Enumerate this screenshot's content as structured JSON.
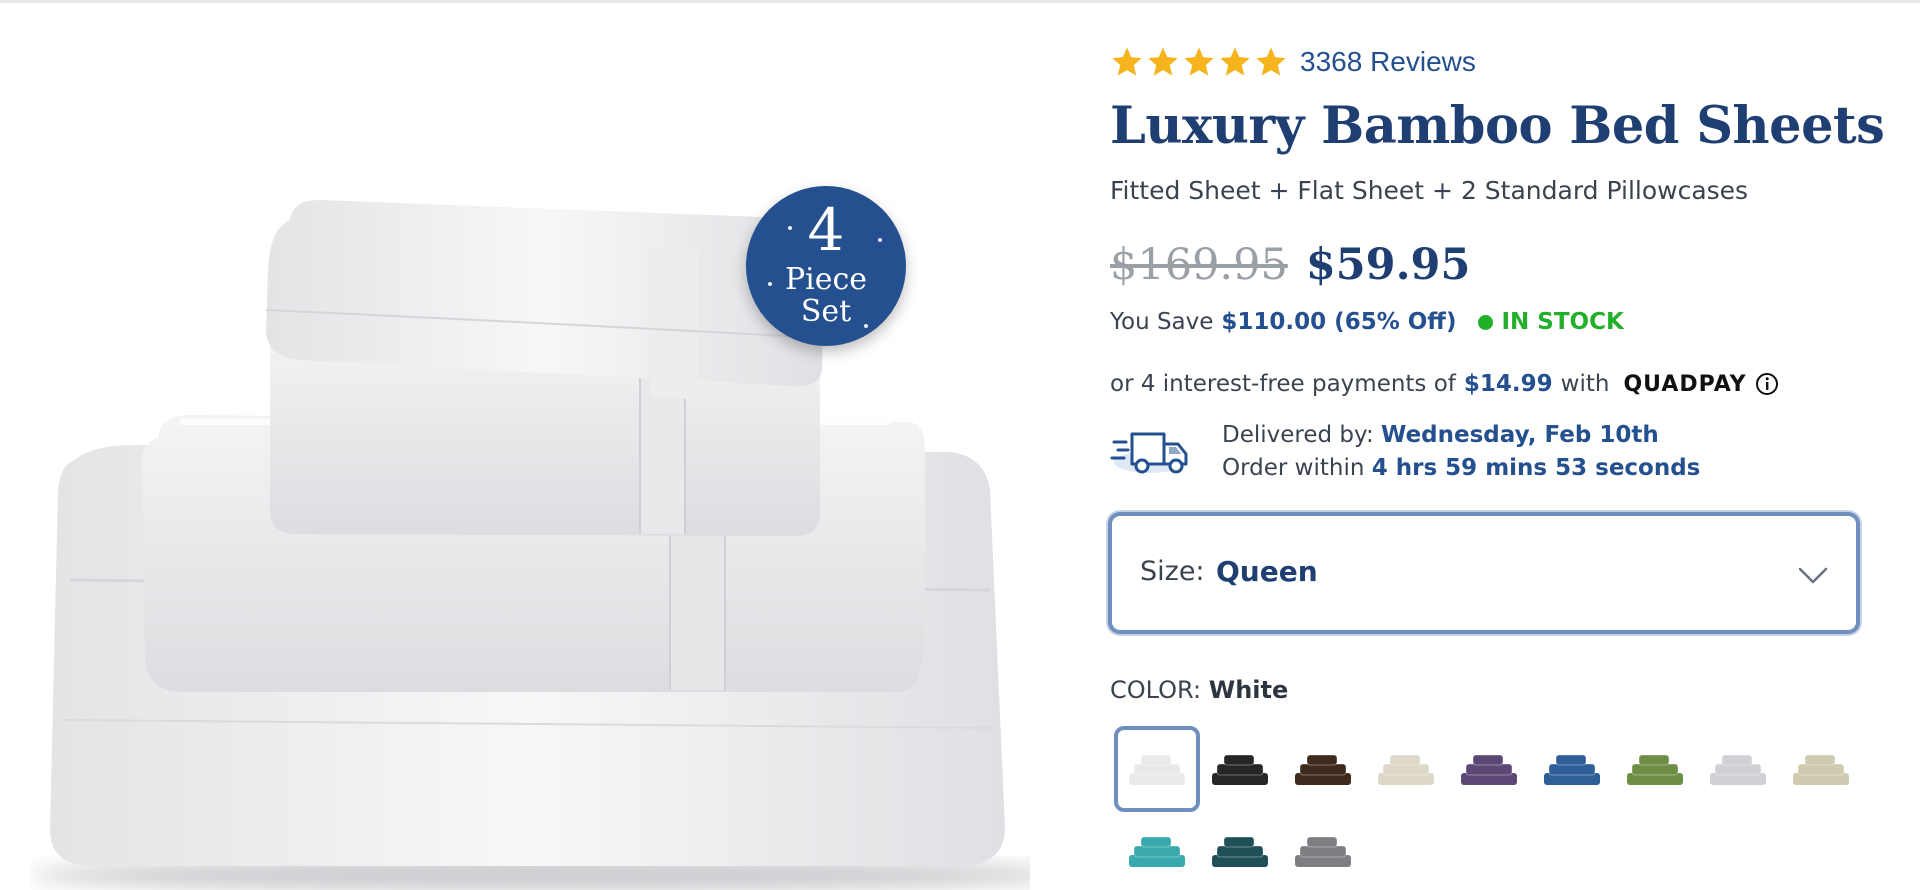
{
  "product": {
    "rating_stars": 5,
    "reviews_label": "3368 Reviews",
    "title": "Luxury Bamboo Bed Sheets",
    "subtitle": "Fitted Sheet + Flat Sheet + 2 Standard Pillowcases",
    "badge": {
      "number": "4",
      "line1": "Piece",
      "line2": "Set"
    }
  },
  "pricing": {
    "original_price": "$169.95",
    "sale_price": "$59.95",
    "save_label": "You Save",
    "save_value": "$110.00 (65% Off)",
    "stock_status": "IN STOCK",
    "stock_color": "#22b02a"
  },
  "payments": {
    "prefix": "or 4 interest-free payments of",
    "amount": "$14.99",
    "suffix": "with",
    "provider": "QUADPAY"
  },
  "delivery": {
    "label": "Delivered by:",
    "date": "Wednesday, Feb 10th",
    "order_label": "Order within",
    "countdown": "4 hrs 59 mins 53 seconds"
  },
  "size_select": {
    "label": "Size:",
    "value": "Queen"
  },
  "color": {
    "label": "COLOR:",
    "selected": "White",
    "swatches": [
      {
        "name": "White",
        "hex": "#e9eaec"
      },
      {
        "name": "Black",
        "hex": "#262626"
      },
      {
        "name": "Brown",
        "hex": "#3f2a1d"
      },
      {
        "name": "Ivory",
        "hex": "#ddd8c7"
      },
      {
        "name": "Purple",
        "hex": "#5b4876"
      },
      {
        "name": "Blue",
        "hex": "#2f5f99"
      },
      {
        "name": "Green",
        "hex": "#6e8e45"
      },
      {
        "name": "Light Gray",
        "hex": "#cfd1d4"
      },
      {
        "name": "Sand",
        "hex": "#cfcab0"
      },
      {
        "name": "Teal",
        "hex": "#38a9ad"
      },
      {
        "name": "Dark Teal",
        "hex": "#1f5058"
      },
      {
        "name": "Gray",
        "hex": "#7c7e81"
      }
    ]
  },
  "colors": {
    "brand_navy": "#1f3f73",
    "link_blue": "#24508f",
    "star_gold": "#f6b51d",
    "select_border": "#6f8fbf"
  }
}
